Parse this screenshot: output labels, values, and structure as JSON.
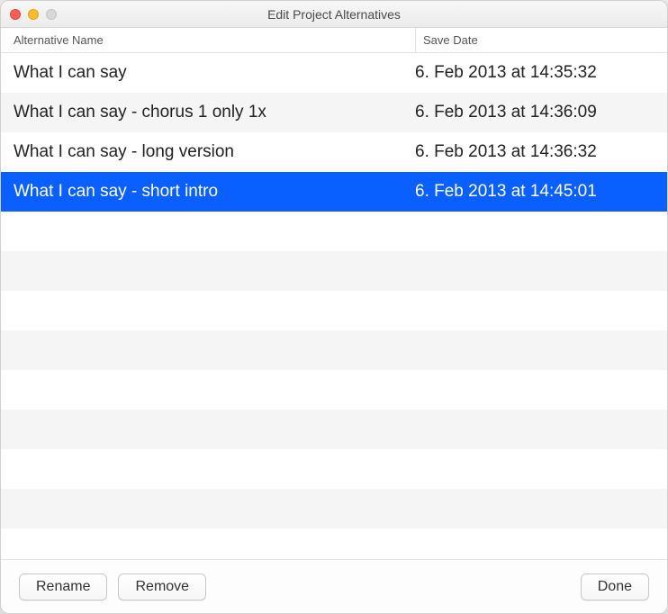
{
  "window": {
    "title": "Edit Project Alternatives"
  },
  "table": {
    "headers": {
      "name": "Alternative Name",
      "date": "Save Date"
    },
    "rows": [
      {
        "name": "What I can say",
        "date": "6. Feb 2013 at 14:35:32",
        "selected": false
      },
      {
        "name": "What I can say - chorus 1 only 1x",
        "date": "6. Feb 2013 at 14:36:09",
        "selected": false
      },
      {
        "name": "What I can say - long version",
        "date": "6. Feb 2013 at 14:36:32",
        "selected": false
      },
      {
        "name": "What I can say - short intro",
        "date": "6. Feb 2013 at 14:45:01",
        "selected": true
      }
    ],
    "total_visible_rows": 12
  },
  "footer": {
    "rename_label": "Rename",
    "remove_label": "Remove",
    "done_label": "Done"
  }
}
